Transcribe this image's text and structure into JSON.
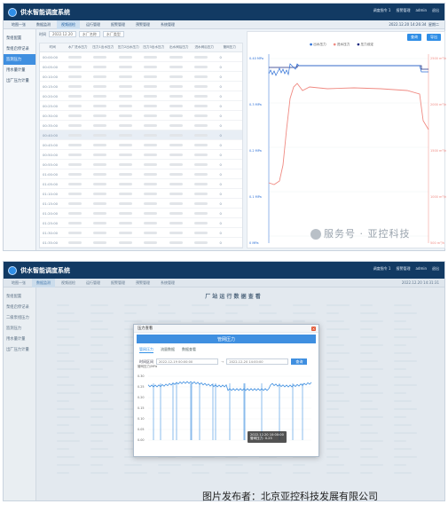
{
  "app": {
    "title": "供水智能调度系统"
  },
  "screen1": {
    "header": {
      "user": "调度指令 1",
      "alarm": "报警管理",
      "admin": "admin",
      "exit": "退出",
      "datetime": "2022.12.20 14:26:34",
      "weekday": "星期二"
    },
    "nav": [
      "地图一张",
      "数据监测",
      "视频巡检",
      "运行管理",
      "报警管理",
      "预警管理",
      "系统管理"
    ],
    "nav_active": 2,
    "sidebar": [
      "泵组配置",
      "泵组启停记录",
      "监测压力",
      "用水量计量",
      "出厂压力计量"
    ],
    "sidebar_active": 2,
    "query": {
      "label": "时间",
      "date": "2022.12.20",
      "factory": "水厂名称",
      "type": "水厂类型"
    },
    "table": {
      "headers": [
        "时间",
        "水厂进水压力",
        "压力1出水压力",
        "压力2出水压力",
        "压力3出水压力",
        "出水阀后压力",
        "进水阀后压力",
        "管网压力"
      ],
      "times": [
        "00:00:00",
        "00:05:00",
        "00:10:00",
        "00:15:00",
        "00:20:00",
        "00:25:00",
        "00:30:00",
        "00:35:00",
        "00:40:00",
        "00:45:00",
        "00:50:00",
        "00:55:00",
        "01:00:00",
        "01:05:00",
        "01:10:00",
        "01:15:00",
        "01:20:00",
        "01:25:00",
        "01:30:00",
        "01:35:00",
        "01:40:00"
      ],
      "last_col": [
        "0",
        "0",
        "0",
        "0",
        "0",
        "0",
        "0",
        "0",
        "0",
        "0",
        "0",
        "0",
        "0",
        "0",
        "0",
        "0",
        "0",
        "0",
        "0",
        "0",
        "0"
      ]
    },
    "chart": {
      "btn_query": "查询",
      "btn_export": "导出",
      "legend": [
        "出水压力",
        "进水压力",
        "压力设定"
      ],
      "left_ticks": [
        "0.40 MPa",
        "0.3 MPa",
        "0.2 MPa",
        "0.1 MPa",
        "0 MPa"
      ],
      "right_ticks": [
        "2500 m³/h",
        "2000 m³/h",
        "1500 m³/h",
        "1000 m³/h",
        "500 m³/h"
      ]
    }
  },
  "screen2": {
    "header": {
      "user": "调度指令 1",
      "alarm": "报警管理",
      "admin": "admin",
      "exit": "退出",
      "datetime": "2022.12.20 14:31:31"
    },
    "nav": [
      "地图一张",
      "数据监测",
      "视频巡检",
      "运行管理",
      "报警管理",
      "预警管理",
      "系统管理"
    ],
    "sidebar": [
      "泵组配置",
      "泵组启停记录",
      "二级泵组压力",
      "监测压力",
      "用水量计量",
      "出厂压力计量"
    ],
    "page_title": "厂 站 运 行 数 据 查 看",
    "modal": {
      "title": "压力查看",
      "banner": "管网压力",
      "tabs": [
        "管网压力",
        "流量数据",
        "数据查看"
      ],
      "active_tab": 0,
      "range_label": "时间区间",
      "start": "2022-12-19 00:00:00",
      "end": "2022-12-20 14:00:00",
      "query": "查询"
    },
    "modal_chart": {
      "ylabel": "管网压力/MPa",
      "ticks": [
        "0.30",
        "0.25",
        "0.20",
        "0.15",
        "0.10",
        "0.05",
        "0.00"
      ],
      "tooltip_time": "2022.12.20 10:00:00",
      "tooltip_value": "管网压力: 0.25"
    }
  },
  "watermark": "服务号 · 亚控科技",
  "credit": "图片发布者：北京亚控科技发展有限公司",
  "colors": {
    "header": "#123a63",
    "accent": "#3f8fe0",
    "series_out": "#2c6fd6",
    "series_in": "#f08a82",
    "series_set": "#1b2a80"
  }
}
